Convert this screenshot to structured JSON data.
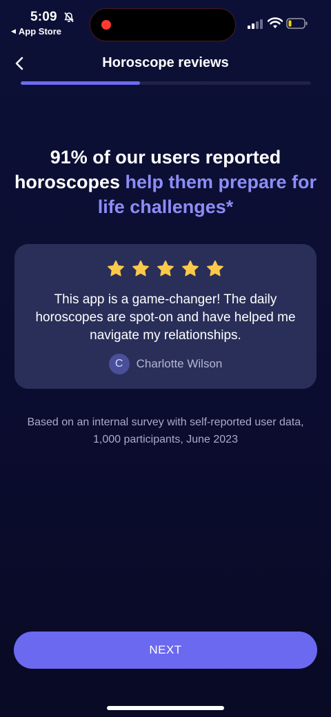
{
  "status_bar": {
    "time": "5:09",
    "back_app_label": "App Store"
  },
  "header": {
    "title": "Horoscope reviews",
    "progress_percent": 41
  },
  "headline": {
    "line_plain": "91% of our users reported horoscopes ",
    "line_accent": "help them prepare for life challenges*"
  },
  "review": {
    "rating": 5,
    "text": "This app is a game-changer! The daily horoscopes are spot-on and have helped me navigate my relationships.",
    "avatar_initial": "C",
    "reviewer_name": "Charlotte Wilson"
  },
  "footnote": "Based on an internal survey with self-reported user data, 1,000 participants, June 2023",
  "next_button_label": "NEXT",
  "colors": {
    "accent": "#6b69f0",
    "accent_text": "#8c8df7",
    "star": "#fbc94a",
    "background": "#0d1036"
  }
}
